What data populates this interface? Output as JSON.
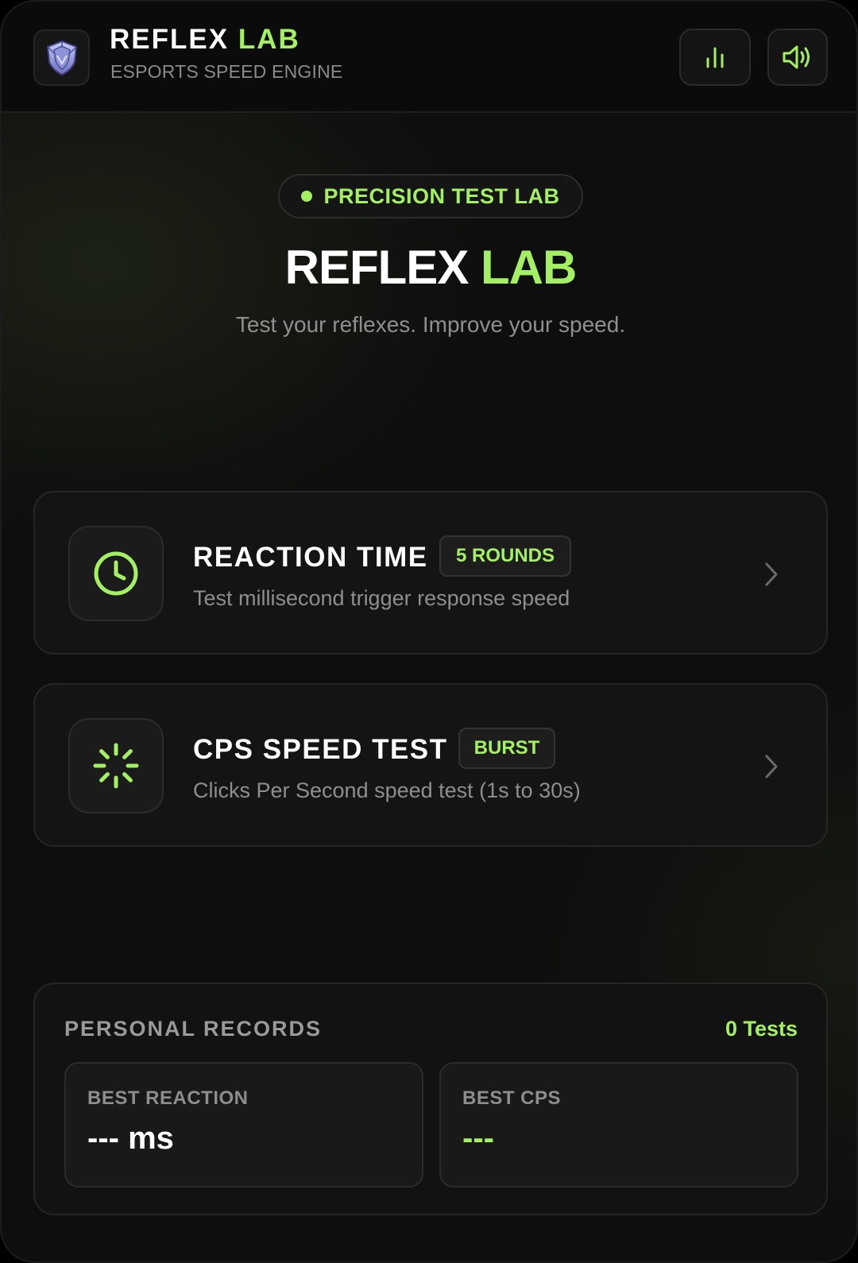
{
  "header": {
    "brand_title_main": "REFLEX",
    "brand_title_accent": "LAB",
    "brand_subtitle": "ESPORTS SPEED ENGINE",
    "logo_icon": "shield-crest-icon",
    "stats_icon": "bar-chart-icon",
    "sound_icon": "speaker-volume-icon"
  },
  "hero": {
    "pill_label": "PRECISION TEST LAB",
    "title_main": "REFLEX",
    "title_accent": "LAB",
    "subtitle": "Test your reflexes. Improve your speed."
  },
  "tests": [
    {
      "title": "REACTION TIME",
      "badge": "5 ROUNDS",
      "description": "Test millisecond trigger response speed",
      "icon": "clock-icon"
    },
    {
      "title": "CPS SPEED TEST",
      "badge": "BURST",
      "description": "Clicks Per Second speed test (1s to 30s)",
      "icon": "loader-burst-icon"
    }
  ],
  "records": {
    "heading": "PERSONAL RECORDS",
    "count": "0 Tests",
    "best_reaction_label": "BEST REACTION",
    "best_reaction_value": "--- ms",
    "best_cps_label": "BEST CPS",
    "best_cps_value": "---"
  },
  "colors": {
    "accent": "#a3f062",
    "background": "#0e0e0e",
    "card": "#141414"
  }
}
